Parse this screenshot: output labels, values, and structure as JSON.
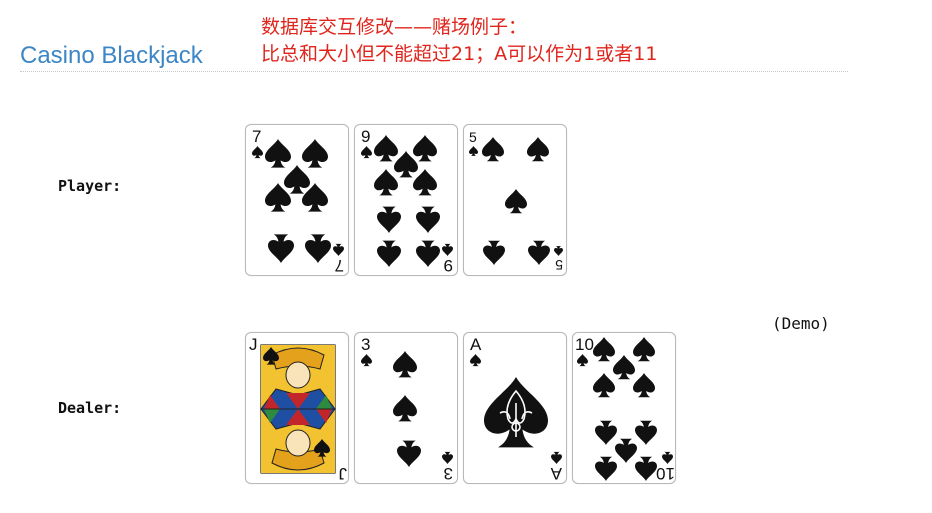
{
  "header": {
    "title": "Casino Blackjack",
    "note_line1": "数据库交互修改——赌场例子：",
    "note_line2": "比总和大小但不能超过21；A可以作为1或者11"
  },
  "player": {
    "label": "Player:",
    "cards": [
      {
        "rank": "7",
        "suit": "spades"
      },
      {
        "rank": "9",
        "suit": "spades"
      },
      {
        "rank": "5",
        "suit": "spades"
      }
    ]
  },
  "dealer": {
    "label": "Dealer:",
    "cards": [
      {
        "rank": "J",
        "suit": "spades"
      },
      {
        "rank": "3",
        "suit": "spades"
      },
      {
        "rank": "A",
        "suit": "spades"
      },
      {
        "rank": "10",
        "suit": "spades"
      }
    ]
  },
  "demo_label": "(Demo)",
  "colors": {
    "title": "#3d86c6",
    "notes": "#e0251d"
  },
  "icons": {
    "suit": "spade-icon"
  }
}
